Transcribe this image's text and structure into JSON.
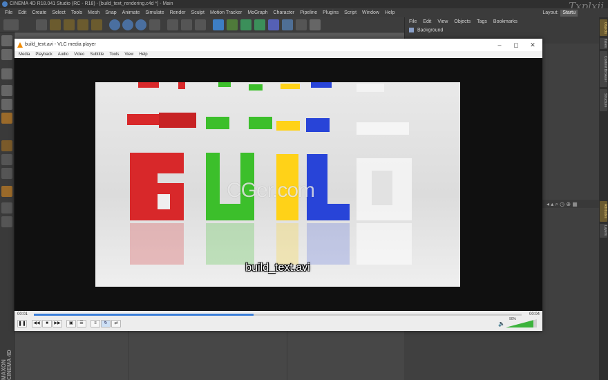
{
  "c4d": {
    "title": "CINEMA 4D R18.041 Studio (RC - R18) - [build_text_rendering.c4d *] - Main",
    "menu": [
      "File",
      "Edit",
      "Create",
      "Select",
      "Tools",
      "Mesh",
      "Snap",
      "Animate",
      "Simulate",
      "Render",
      "Sculpt",
      "Motion Tracker",
      "MoGraph",
      "Character",
      "Pipeline",
      "Plugins",
      "Script",
      "Window",
      "Help"
    ],
    "layout_label": "Layout:",
    "layout_value": "Startu",
    "watermark": "Txplxii",
    "object_manager": {
      "menu": [
        "File",
        "Edit",
        "View",
        "Objects",
        "Tags",
        "Bookmarks"
      ],
      "row_label": "Background"
    },
    "side_tabs": [
      "Objects",
      "Takes",
      "Content Browser",
      "Structure",
      "Attributes",
      "Layers"
    ],
    "brand": "MAXON CINEMA 4D",
    "colors": {
      "accent": "#f5a623",
      "blue": "#4a7fc1"
    }
  },
  "vlc": {
    "title": "build_text.avi - VLC media player",
    "menu": [
      "Media",
      "Playback",
      "Audio",
      "Video",
      "Subtitle",
      "Tools",
      "View",
      "Help"
    ],
    "subtitle": "build_text.avi",
    "watermark": "CGer.com",
    "time_elapsed": "00:01",
    "time_total": "00:04",
    "progress_pct": 45,
    "volume": "90%",
    "window_controls": [
      "minimize-icon",
      "maximize-icon",
      "close-icon"
    ]
  }
}
